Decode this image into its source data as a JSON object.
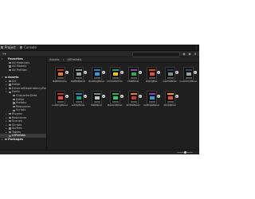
{
  "tabs": [
    {
      "label": "Project",
      "active": true
    },
    {
      "label": "Console",
      "active": false
    }
  ],
  "sidebar": {
    "rows": [
      {
        "label": "Favorites",
        "level": 0,
        "header": true,
        "arrow": "▾",
        "folder": false
      },
      {
        "label": "All Materials",
        "level": 1,
        "header": false,
        "arrow": "",
        "folder": true
      },
      {
        "label": "All Models",
        "level": 1,
        "header": false,
        "arrow": "",
        "folder": true
      },
      {
        "label": "All Prefabs",
        "level": 1,
        "header": false,
        "arrow": "",
        "folder": true
      },
      {
        "label": "",
        "level": 0,
        "header": false,
        "arrow": "",
        "folder": false
      },
      {
        "label": "Assets",
        "level": 0,
        "header": true,
        "arrow": "▾",
        "folder": true
      },
      {
        "label": "Art",
        "level": 1,
        "header": false,
        "arrow": "▸",
        "folder": true
      },
      {
        "label": "Editor",
        "level": 1,
        "header": false,
        "arrow": "▸",
        "folder": true
      },
      {
        "label": "ExternalDependencyManager",
        "level": 1,
        "header": false,
        "arrow": "▸",
        "folder": true
      },
      {
        "label": "Fonts",
        "level": 1,
        "header": false,
        "arrow": "▾",
        "folder": true
      },
      {
        "label": "CharacterData",
        "level": 2,
        "header": false,
        "arrow": "",
        "folder": true
      },
      {
        "label": "Editor",
        "level": 2,
        "header": false,
        "arrow": "",
        "folder": true
      },
      {
        "label": "Prefabs",
        "level": 2,
        "header": false,
        "arrow": "",
        "folder": true
      },
      {
        "label": "Resources",
        "level": 2,
        "header": false,
        "arrow": "",
        "folder": true
      },
      {
        "label": "Scripts",
        "level": 2,
        "header": false,
        "arrow": "",
        "folder": true
      },
      {
        "label": "Plugins",
        "level": 1,
        "header": false,
        "arrow": "▸",
        "folder": true
      },
      {
        "label": "Resources",
        "level": 1,
        "header": false,
        "arrow": "▸",
        "folder": true
      },
      {
        "label": "Scenes",
        "level": 1,
        "header": false,
        "arrow": "▸",
        "folder": true
      },
      {
        "label": "Scripts",
        "level": 1,
        "header": false,
        "arrow": "▸",
        "folder": true
      },
      {
        "label": "Sprites",
        "level": 1,
        "header": false,
        "arrow": "▸",
        "folder": true
      },
      {
        "label": "Tables",
        "level": 1,
        "header": false,
        "arrow": "▸",
        "folder": true
      },
      {
        "label": "UIPrefabs",
        "level": 1,
        "header": false,
        "arrow": "",
        "folder": true,
        "selected": true
      },
      {
        "label": "Packages",
        "level": 0,
        "header": true,
        "arrow": "▸",
        "folder": true
      }
    ]
  },
  "breadcrumb": [
    "Assets",
    "UIPrefabs"
  ],
  "assets": [
    {
      "label": "BattleScene",
      "color1": "#c0392b",
      "color2": "#e67e22"
    },
    {
      "label": "BattleResult",
      "color1": "#7f8c8d",
      "color2": "#95a5a6"
    },
    {
      "label": "BuildingPanel",
      "color1": "#2980b9",
      "color2": "#3498db"
    },
    {
      "label": "CharacterInfo",
      "color1": "#16a085",
      "color2": "#f1c40f"
    },
    {
      "label": "ChatPanel",
      "color1": "#8e44ad",
      "color2": "#27ae60"
    },
    {
      "label": "DialogBox",
      "color1": "#d35400",
      "color2": "#e74c3c"
    },
    {
      "label": "GachaPanel",
      "color1": "#2c3e50",
      "color2": "#7f8c8d"
    },
    {
      "label": "InventoryPanel",
      "color1": "#34495e",
      "color2": "#95a5a6"
    },
    {
      "label": "LoadingPanel",
      "color1": "#c0392b",
      "color2": "#e74c3c"
    },
    {
      "label": "LobbyPanel",
      "color1": "#2980b9",
      "color2": "#16a085"
    },
    {
      "label": "MailPanel",
      "color1": "#7f8c8d",
      "color2": "#bdc3c7"
    },
    {
      "label": "MissionPanel",
      "color1": "#27ae60",
      "color2": "#2ecc71"
    },
    {
      "label": "ProfilePanel",
      "color1": "#e67e22",
      "color2": "#c0392b"
    },
    {
      "label": "SettingsPanel",
      "color1": "#8e44ad",
      "color2": "#3498db"
    },
    {
      "label": "ShopPanel",
      "color1": "#f39c12",
      "color2": "#e74c3c"
    }
  ],
  "zoom": 0.5
}
